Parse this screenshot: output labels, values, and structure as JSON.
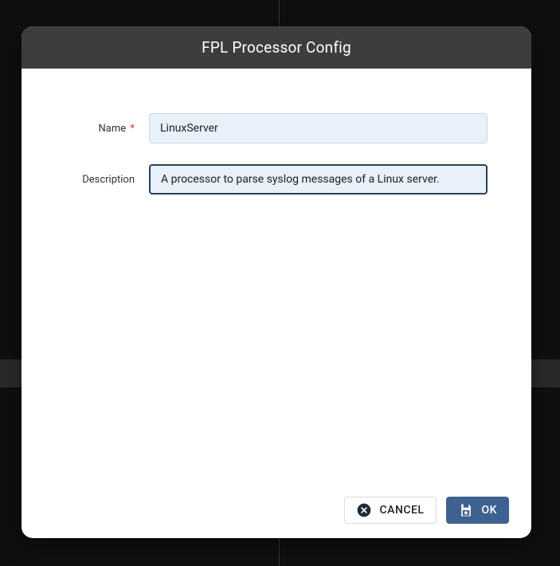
{
  "modal": {
    "title": "FPL Processor Config"
  },
  "form": {
    "name": {
      "label": "Name",
      "required": "*",
      "value": "LinuxServer"
    },
    "description": {
      "label": "Description",
      "value": "A processor to parse syslog messages of a Linux server."
    }
  },
  "buttons": {
    "cancel": "CANCEL",
    "ok": "OK"
  }
}
